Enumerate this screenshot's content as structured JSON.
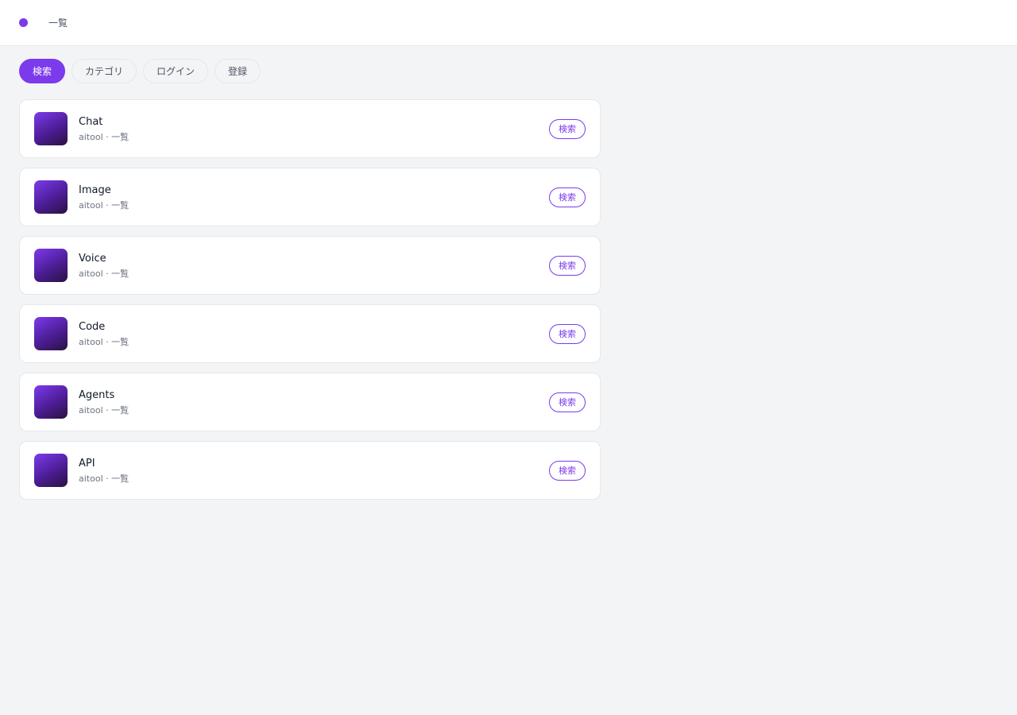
{
  "header": {
    "logo_icon": "circle-dot-icon",
    "nav_label": "一覧"
  },
  "tabs": [
    {
      "label": "検索",
      "active": true
    },
    {
      "label": "カテゴリ",
      "active": false
    },
    {
      "label": "ログイン",
      "active": false
    },
    {
      "label": "登録",
      "active": false
    }
  ],
  "items": [
    {
      "title": "Chat",
      "source": "aitool",
      "separator": "·",
      "category": "一覧",
      "action_label": "検索"
    },
    {
      "title": "Image",
      "source": "aitool",
      "separator": "·",
      "category": "一覧",
      "action_label": "検索"
    },
    {
      "title": "Voice",
      "source": "aitool",
      "separator": "·",
      "category": "一覧",
      "action_label": "検索"
    },
    {
      "title": "Code",
      "source": "aitool",
      "separator": "·",
      "category": "一覧",
      "action_label": "検索"
    },
    {
      "title": "Agents",
      "source": "aitool",
      "separator": "·",
      "category": "一覧",
      "action_label": "検索"
    },
    {
      "title": "API",
      "source": "aitool",
      "separator": "·",
      "category": "一覧",
      "action_label": "検索"
    }
  ],
  "colors": {
    "accent": "#7c3aed",
    "background": "#f3f4f6",
    "card": "#ffffff",
    "thumbnail_gradient_end": "#2a1240"
  }
}
